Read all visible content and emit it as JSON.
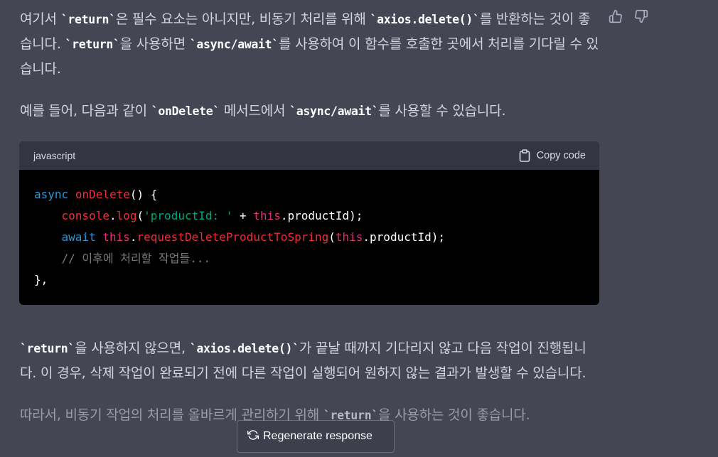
{
  "message": {
    "p1": {
      "t1": "여기서 ",
      "c1": "`return`",
      "t2": "은 필수 요소는 아니지만, 비동기 처리를 위해 ",
      "c2": "`axios.delete()`",
      "t3": "를 반환하는 것이 좋습니다. ",
      "c3": "`return`",
      "t4": "을 사용하면 ",
      "c4": "`async/await`",
      "t5": "를 사용하여 이 함수를 호출한 곳에서 처리를 기다릴 수 있습니다."
    },
    "p2": {
      "t1": "예를 들어, 다음과 같이 ",
      "c1": "`onDelete`",
      "t2": " 메서드에서 ",
      "c2": "`async/await`",
      "t3": "를 사용할 수 있습니다."
    },
    "p3": {
      "c1": "`return`",
      "t1": "을 사용하지 않으면, ",
      "c2": "`axios.delete()`",
      "t2": "가 끝날 때까지 기다리지 않고 다음 작업이 진행됩니다. 이 경우, 삭제 작업이 완료되기 전에 다른 작업이 실행되어 원하지 않는 결과가 발생할 수 있습니다."
    },
    "p4": {
      "t1": "따라서, 비동기 작업의 처리를 올바르게 관리하기 위해 ",
      "c1": "`return`",
      "t2": "을 사용하는 것이 좋습니다."
    }
  },
  "code_block": {
    "language": "javascript",
    "copy_label": "Copy code",
    "lines": {
      "l1": {
        "kw": "async",
        "sp": " ",
        "fn": "onDelete",
        "rest": "() {"
      },
      "l2": {
        "indent": "    ",
        "obj": "console",
        "dot": ".",
        "fn": "log",
        "p1": "(",
        "str": "'productId: '",
        "op": " + ",
        "this": "this",
        "rest": ".productId);"
      },
      "l3": {
        "indent": "    ",
        "kw": "await",
        "sp": " ",
        "this": "this",
        "dot": ".",
        "fn": "requestDeleteProductToSpring",
        "p1": "(",
        "this2": "this",
        "rest": ".productId);"
      },
      "l4": {
        "indent": "    ",
        "comment": "// 이후에 처리할 작업들..."
      },
      "l5": {
        "text": "},"
      }
    }
  },
  "feedback": {
    "thumbs_up": "thumbs-up-icon",
    "thumbs_down": "thumbs-down-icon"
  },
  "regenerate": {
    "label": "Regenerate response",
    "icon": "refresh-icon"
  },
  "colors": {
    "background": "#444654",
    "text": "#d1d5db",
    "code_bg": "#000000",
    "code_header_bg": "#343541",
    "keyword": "#2e95d3",
    "function": "#f22c3d",
    "string": "#00a67d",
    "this": "#df3079",
    "comment": "#7a7a7a"
  }
}
